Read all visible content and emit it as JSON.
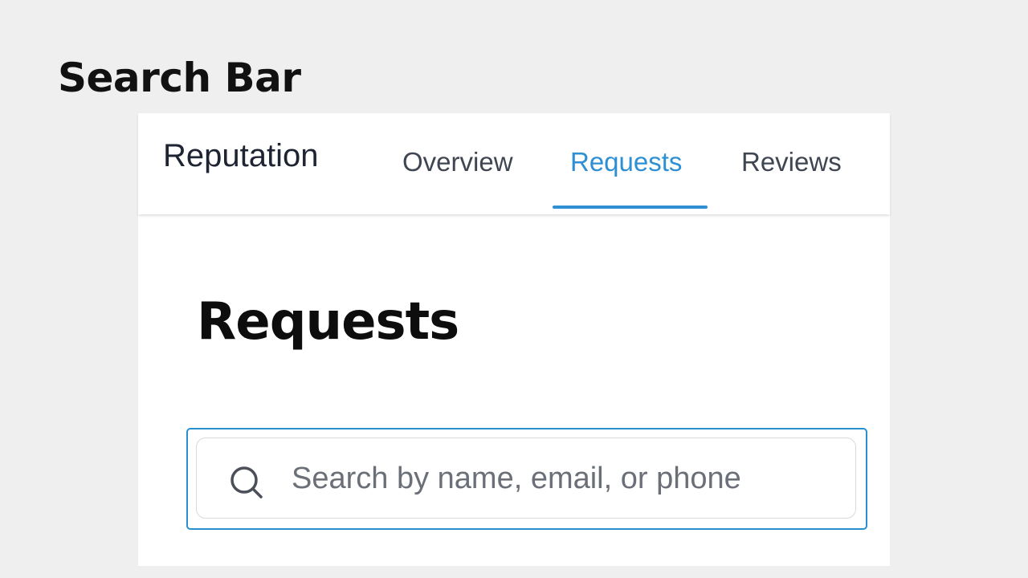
{
  "slide": {
    "title": "Search Bar"
  },
  "app": {
    "name": "Reputation",
    "tabs": [
      {
        "label": "Overview",
        "active": false
      },
      {
        "label": "Requests",
        "active": true
      },
      {
        "label": "Reviews",
        "active": false
      }
    ]
  },
  "main": {
    "heading": "Requests",
    "search": {
      "placeholder": "Search by name, email, or phone",
      "value": "",
      "icon": "search-icon"
    }
  },
  "colors": {
    "accent": "#2e8fd3",
    "background": "#efefef",
    "surface": "#ffffff",
    "text_dark": "#1f2433",
    "tab_text": "#3f4652",
    "placeholder": "#6b6f77"
  }
}
